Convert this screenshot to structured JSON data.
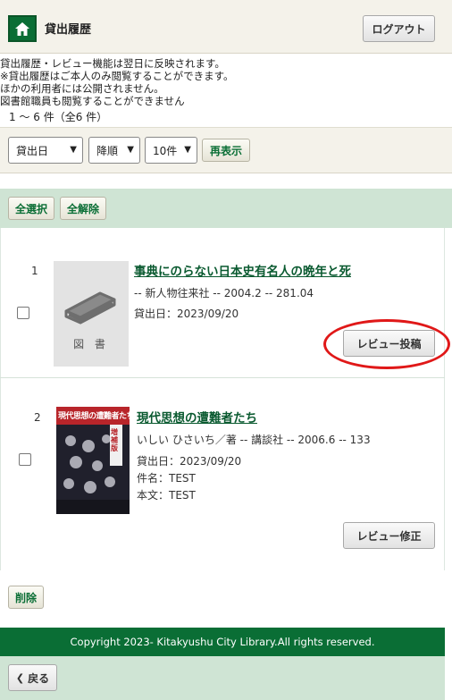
{
  "header": {
    "title": "貸出履歴",
    "logout_label": "ログアウト",
    "home_icon": "home-icon"
  },
  "notice": {
    "lines": [
      "貸出履歴・レビュー機能は翌日に反映されます。",
      "※貸出履歴はご本人のみ閲覧することができます。",
      "ほかの利用者には公開されません。",
      "図書館職員も閲覧することができません"
    ],
    "count": "1 〜 6 件（全6 件）"
  },
  "filters": {
    "sort_field": "貸出日",
    "sort_order": "降順",
    "per_page": "10件",
    "redisplay_label": "再表示"
  },
  "selection": {
    "select_all": "全選択",
    "clear_all": "全解除"
  },
  "items": [
    {
      "number": "1",
      "title": "事典にのらない日本史有名人の晩年と死",
      "meta": "-- 新人物往来社 -- 2004.2 -- 281.04",
      "loan_date": "貸出日：2023/09/20",
      "placeholder_label": "図 書",
      "review_label": "レビュー投稿"
    },
    {
      "number": "2",
      "title": "現代思想の遭難者たち",
      "meta": "いしい ひさいち／著 -- 講談社 -- 2006.6 -- 133",
      "loan_date": "貸出日：2023/09/20",
      "subject": "件名：TEST",
      "body": "本文：TEST",
      "cover_text": "現代思想の遭難者たち",
      "cover_sub": "増補版",
      "review_label": "レビュー修正"
    }
  ],
  "delete_label": "削除",
  "footer": {
    "copyright": "Copyright 2023- Kitakyushu City Library.All rights reserved."
  },
  "back_label": "戻る",
  "colors": {
    "brand_green": "#0a6e35",
    "light_green": "#cfe4d4",
    "beige": "#f4f2ea",
    "annotation_red": "#e01818"
  }
}
